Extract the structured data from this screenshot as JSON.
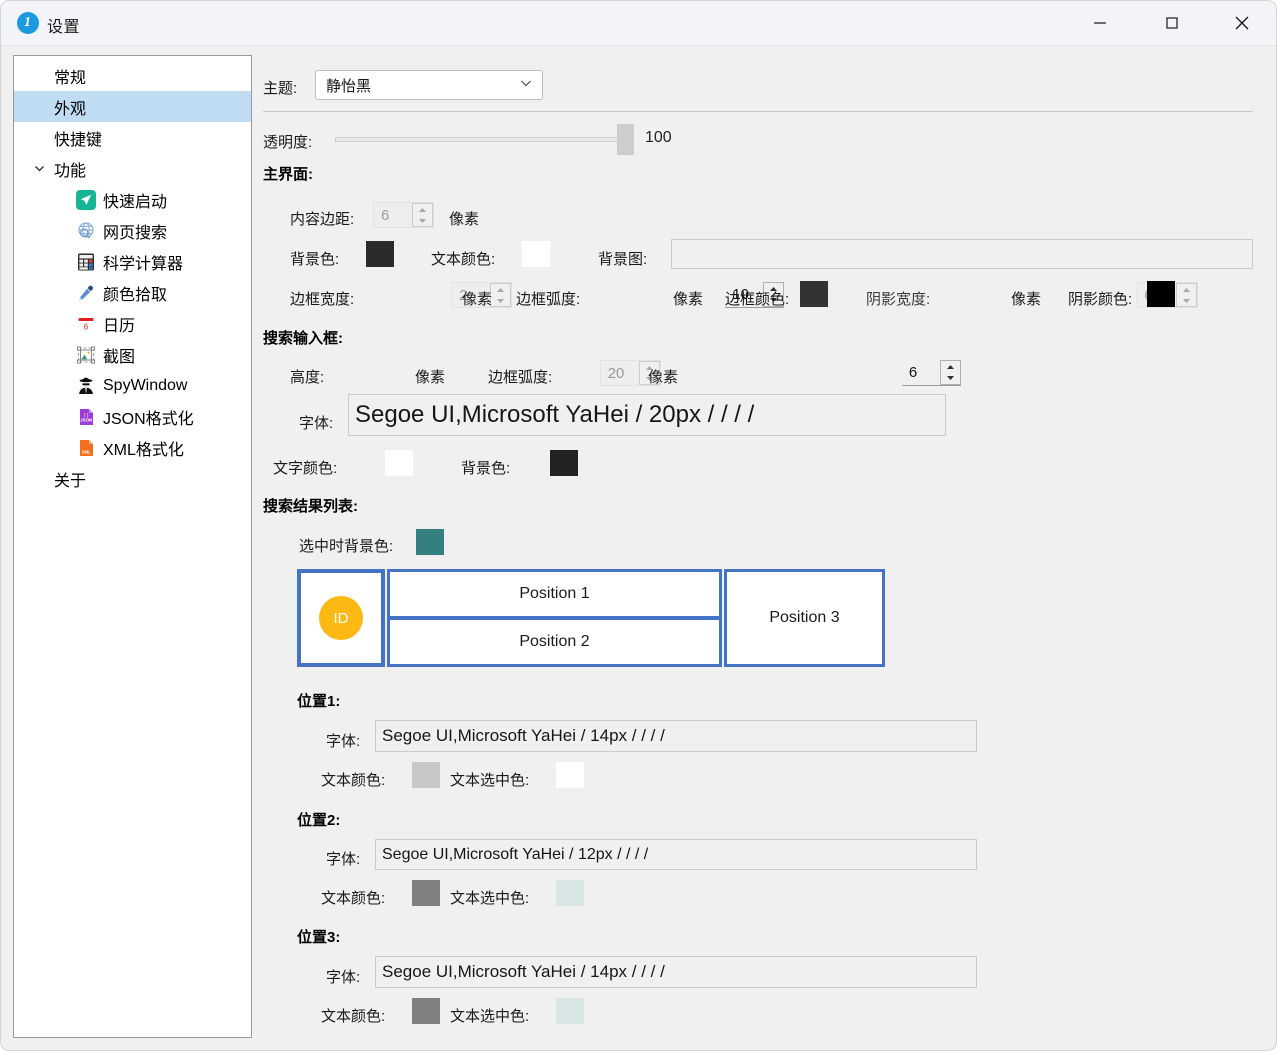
{
  "window": {
    "title": "设置",
    "app_icon": "info-circle-icon",
    "minimize_label": "−",
    "maximize_label": "□",
    "close_label": "✕"
  },
  "sidebar": {
    "items": [
      {
        "label": "常规",
        "level": "top",
        "icon": null,
        "selected": false,
        "expander": null
      },
      {
        "label": "外观",
        "level": "top",
        "icon": null,
        "selected": true,
        "expander": null
      },
      {
        "label": "快捷键",
        "level": "top",
        "icon": null,
        "selected": false,
        "expander": null
      },
      {
        "label": "功能",
        "level": "top",
        "icon": null,
        "selected": false,
        "expander": "chevron-down-icon"
      },
      {
        "label": "快速启动",
        "level": "child",
        "icon": "send-plane-icon",
        "selected": false,
        "expander": null
      },
      {
        "label": "网页搜索",
        "level": "child",
        "icon": "globe-icon",
        "selected": false,
        "expander": null
      },
      {
        "label": "科学计算器",
        "level": "child",
        "icon": "calculator-icon",
        "selected": false,
        "expander": null
      },
      {
        "label": "颜色拾取",
        "level": "child",
        "icon": "eyedropper-icon",
        "selected": false,
        "expander": null
      },
      {
        "label": "日历",
        "level": "child",
        "icon": "calendar-icon",
        "selected": false,
        "expander": null
      },
      {
        "label": "截图",
        "level": "child",
        "icon": "screenshot-icon",
        "selected": false,
        "expander": null
      },
      {
        "label": "SpyWindow",
        "level": "child",
        "icon": "spy-icon",
        "selected": false,
        "expander": null
      },
      {
        "label": "JSON格式化",
        "level": "child",
        "icon": "json-file-icon",
        "selected": false,
        "expander": null
      },
      {
        "label": "XML格式化",
        "level": "child",
        "icon": "xml-file-icon",
        "selected": false,
        "expander": null
      },
      {
        "label": "关于",
        "level": "top",
        "icon": null,
        "selected": false,
        "expander": null
      }
    ]
  },
  "pane": {
    "theme": {
      "label": "主题:",
      "value": "静怡黑"
    },
    "transparency": {
      "label": "透明度:",
      "value": "100"
    },
    "main_interface": {
      "title": "主界面:",
      "content_margin_label": "内容边距:",
      "content_margin_value": "6",
      "content_margin_unit": "像素",
      "background_color_label": "背景色:",
      "background_color_value": "#2b2b2b",
      "text_color_label": "文本颜色:",
      "text_color_value": "#ffffff",
      "background_image_label": "背景图:",
      "background_image_value": "",
      "border_width_label": "边框宽度:",
      "border_width_value": "2",
      "border_width_unit": "像素",
      "border_radius_label": "边框弧度:",
      "border_radius_value": "10",
      "border_radius_unit": "像素",
      "border_color_label": "边框颜色:",
      "border_color_value": "#333333",
      "shadow_width_label": "阴影宽度:",
      "shadow_width_value": "0",
      "shadow_width_unit": "像素",
      "shadow_color_label": "阴影颜色:",
      "shadow_color_value": "#000000"
    },
    "search_input": {
      "title": "搜索输入框:",
      "height_label": "高度:",
      "height_value": "20",
      "height_unit": "像素",
      "radius_label": "边框弧度:",
      "radius_value": "6",
      "radius_unit": "像素",
      "font_label": "字体:",
      "font_value": "Segoe UI,Microsoft YaHei / 20px /  /  /  / ",
      "text_color_label": "文字颜色:",
      "text_color_value": "#ffffff",
      "background_color_label": "背景色:",
      "background_color_value": "#232323"
    },
    "result_list": {
      "title": "搜索结果列表:",
      "selected_bg_label": "选中时背景色:",
      "selected_bg_value": "#35807f",
      "diagram": {
        "id_label": "ID",
        "cells": [
          "Position 1",
          "Position 2",
          "Position 3"
        ],
        "border_color": "#4472c4",
        "id_circle_color": "#fdb913"
      },
      "positions": [
        {
          "title": "位置1:",
          "font_label": "字体:",
          "font_value": "Segoe UI,Microsoft YaHei / 14px /  /  /  / ",
          "text_color_label": "文本颜色:",
          "text_color_value": "#c8c8c8",
          "select_color_label": "文本选中色:",
          "select_color_value": "#ffffff"
        },
        {
          "title": "位置2:",
          "font_label": "字体:",
          "font_value": "Segoe UI,Microsoft YaHei / 12px /  /  /  / ",
          "text_color_label": "文本颜色:",
          "text_color_value": "#808080",
          "select_color_label": "文本选中色:",
          "select_color_value": "#d9e6e6"
        },
        {
          "title": "位置3:",
          "font_label": "字体:",
          "font_value": "Segoe UI,Microsoft YaHei / 14px /  /  /  / ",
          "text_color_label": "文本颜色:",
          "text_color_value": "#808080",
          "select_color_label": "文本选中色:",
          "select_color_value": "#d9e6e6"
        }
      ]
    }
  }
}
